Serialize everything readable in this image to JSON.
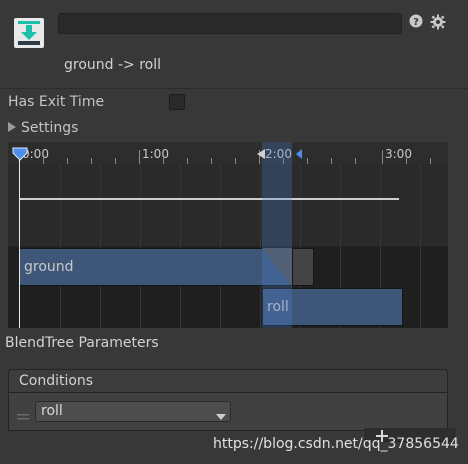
{
  "header": {
    "name_value": "",
    "transition_title": "ground -> roll",
    "icons": [
      "transition-icon",
      "help-icon",
      "gear-icon"
    ]
  },
  "settings": {
    "has_exit_time_label": "Has Exit Time",
    "has_exit_time_checked": false,
    "settings_label": "Settings"
  },
  "timeline": {
    "ticks": [
      "0:00",
      "1:00",
      "2:00",
      "3:00"
    ],
    "source_state": "ground",
    "destination_state": "roll"
  },
  "blend_tree_label": "BlendTree Parameters",
  "conditions": {
    "title": "Conditions",
    "items": [
      {
        "parameter": "roll"
      }
    ]
  },
  "watermark": "https://blog.csdn.net/qq_37856544",
  "colors": {
    "background": "#383838",
    "timeline_bar": "#3e5779",
    "accent_marker": "#4f8fe8",
    "transition_icon": "#1bbfaa"
  }
}
